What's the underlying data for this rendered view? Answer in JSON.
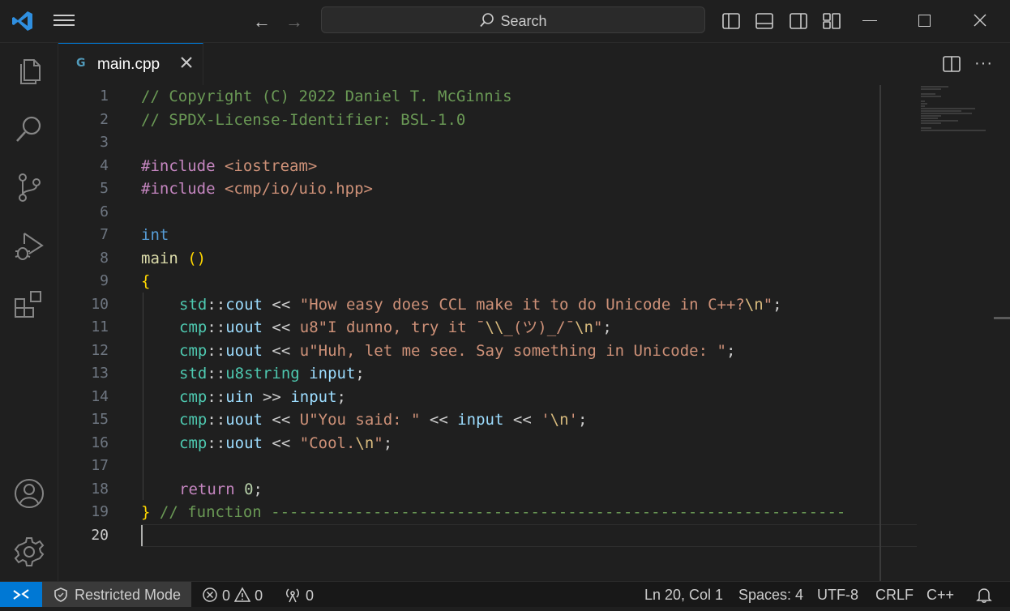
{
  "titlebar": {
    "search_placeholder": "Search",
    "nav_back_glyph": "←",
    "nav_forward_glyph": "→"
  },
  "activity_bar": {
    "items": [
      "explorer-icon",
      "search-icon",
      "source-control-icon",
      "run-debug-icon",
      "extensions-icon",
      "account-icon",
      "settings-gear-icon"
    ]
  },
  "tab": {
    "icon_text": "G",
    "filename": "main.cpp"
  },
  "editor": {
    "line_numbers": [
      "1",
      "2",
      "3",
      "4",
      "5",
      "6",
      "7",
      "8",
      "9",
      "10",
      "11",
      "12",
      "13",
      "14",
      "15",
      "16",
      "17",
      "18",
      "19",
      "20"
    ],
    "current_line": 20,
    "lines": [
      "// Copyright (C) 2022 Daniel T. McGinnis",
      "// SPDX-License-Identifier: BSL-1.0",
      "",
      "#include <iostream>",
      "#include <cmp/io/uio.hpp>",
      "",
      "int",
      "main ()",
      "{",
      "std::cout << \"How easy does CCL make it to do Unicode in C++?\\n\";",
      "cmp::uout << u8\"I dunno, try it ¯\\\\_(ツ)_/¯\\n\";",
      "cmp::uout << u\"Huh, let me see. Say something in Unicode: \";",
      "std::u8string input;",
      "cmp::uin >> input;",
      "cmp::uout << U\"You said: \" << input << '\\n';",
      "cmp::uout << \"Cool.\\n\";",
      "",
      "return 0;",
      "} // function --------------------------------------------------------------",
      ""
    ]
  },
  "statusbar": {
    "restricted_mode": "Restricted Mode",
    "errors": "0",
    "warnings": "0",
    "ports": "0",
    "cursor_position": "Ln 20, Col 1",
    "indentation": "Spaces: 4",
    "encoding": "UTF-8",
    "line_ending": "CRLF",
    "language": "C++"
  },
  "colors": {
    "accent": "#0078d4",
    "background": "#1f1f1f",
    "comment": "#6a9955",
    "string": "#ce9178",
    "keyword": "#c586c0",
    "type": "#569cd6",
    "namespace": "#4ec9b0"
  }
}
